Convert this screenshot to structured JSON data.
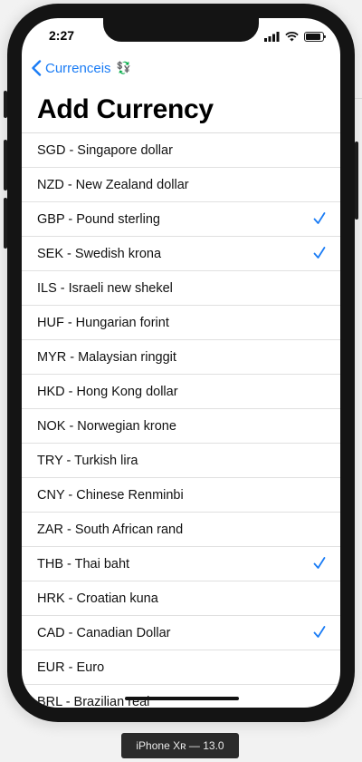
{
  "status_bar": {
    "time": "2:27"
  },
  "nav": {
    "back_label": "Currenceis",
    "back_emoji": "💱"
  },
  "page": {
    "title": "Add Currency"
  },
  "currencies": [
    {
      "label": "SGD - Singapore dollar",
      "checked": false
    },
    {
      "label": "NZD - New Zealand dollar",
      "checked": false
    },
    {
      "label": "GBP - Pound sterling",
      "checked": true
    },
    {
      "label": "SEK - Swedish krona",
      "checked": true
    },
    {
      "label": "ILS - Israeli new shekel",
      "checked": false
    },
    {
      "label": "HUF - Hungarian forint",
      "checked": false
    },
    {
      "label": "MYR - Malaysian ringgit",
      "checked": false
    },
    {
      "label": "HKD - Hong Kong dollar",
      "checked": false
    },
    {
      "label": "NOK - Norwegian krone",
      "checked": false
    },
    {
      "label": "TRY - Turkish lira",
      "checked": false
    },
    {
      "label": "CNY - Chinese Renminbi",
      "checked": false
    },
    {
      "label": "ZAR - South African rand",
      "checked": false
    },
    {
      "label": "THB - Thai baht",
      "checked": true
    },
    {
      "label": "HRK - Croatian kuna",
      "checked": false
    },
    {
      "label": "CAD - Canadian Dollar",
      "checked": true
    },
    {
      "label": "EUR - Euro",
      "checked": false
    },
    {
      "label": "BRL - Brazilian real",
      "checked": false
    }
  ],
  "device": {
    "label": "iPhone Xʀ — 13.0"
  },
  "colors": {
    "accent": "#1a7cf5",
    "checkmark": "#1a7cf5"
  }
}
